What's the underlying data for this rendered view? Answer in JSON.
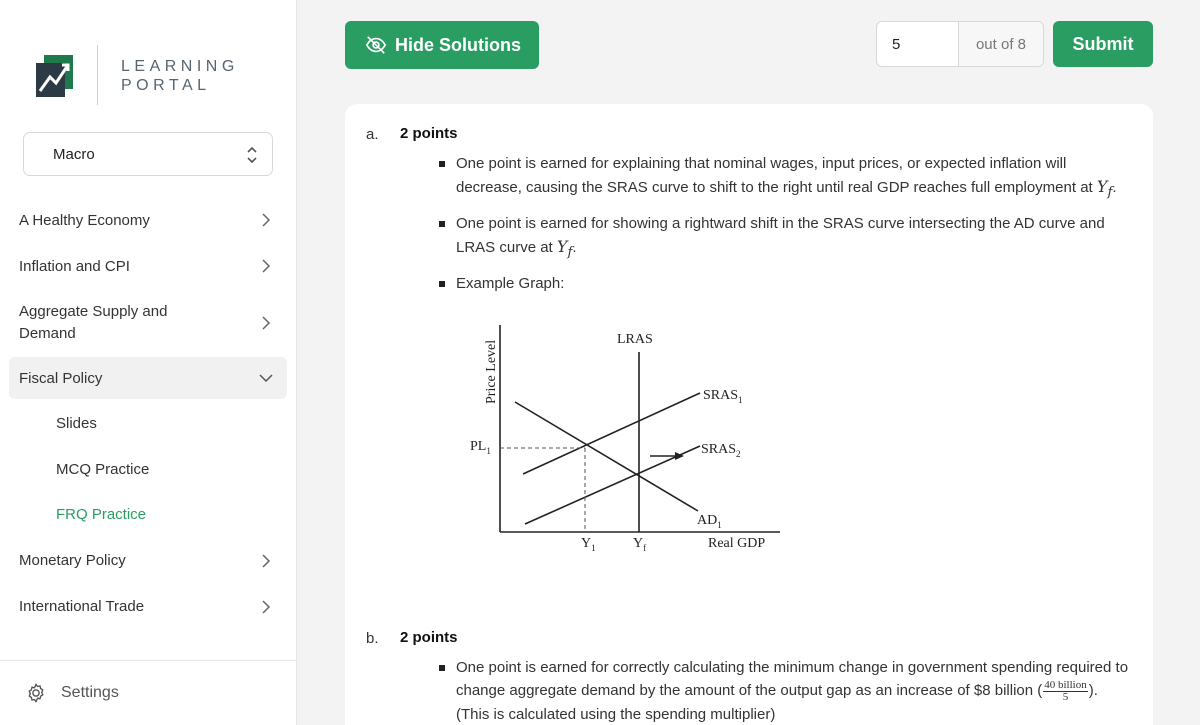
{
  "brand": {
    "line1": "LEARNING",
    "line2": "PORTAL"
  },
  "course_select": {
    "value": "Macro"
  },
  "nav": {
    "items": [
      {
        "label": "A Healthy Economy"
      },
      {
        "label": "Inflation and CPI"
      },
      {
        "label": "Aggregate Supply and Demand"
      },
      {
        "label": "Fiscal Policy"
      },
      {
        "label": "Monetary Policy"
      },
      {
        "label": "International Trade"
      }
    ],
    "fiscal_subitems": [
      {
        "label": "Slides"
      },
      {
        "label": "MCQ Practice"
      },
      {
        "label": "FRQ Practice"
      }
    ]
  },
  "settings": {
    "label": "Settings"
  },
  "toolbar": {
    "hide_solutions_label": "Hide Solutions",
    "current_question": "5",
    "out_of_label": "out of 8",
    "submit_label": "Submit"
  },
  "colors": {
    "accent": "#2a9d62",
    "background": "#f3f3f3"
  },
  "parts": {
    "a": {
      "letter": "a.",
      "points": "2 points",
      "bullet1": "One point is earned for explaining that nominal wages, input prices, or expected inflation will decrease, causing the SRAS curve to shift to the right until real GDP reaches full employment at",
      "bullet2": "One point is earned for showing a rightward shift in the SRAS curve intersecting the AD curve and LRAS curve at",
      "bullet3": "Example Graph:",
      "math_yf": "Y",
      "math_sub": "f",
      "period": "."
    },
    "b": {
      "letter": "b.",
      "points": "2 points",
      "bullet1_main": "One point is earned for correctly calculating the minimum change in government spending required to change aggregate demand by the amount of the output gap as an increase of $8 billion (",
      "frac_num": "40 billion",
      "frac_den": "5",
      "bullet1_tail": "). (This is calculated using the spending multiplier)"
    }
  },
  "graph": {
    "ylabel": "Price Level",
    "xlabel": "Real GDP",
    "lras": "LRAS",
    "sras1": "SRAS",
    "sras1_sub": "1",
    "sras2": "SRAS",
    "sras2_sub": "2",
    "ad": "AD",
    "ad_sub": "1",
    "pl": "PL",
    "pl_sub": "1",
    "y1": "Y",
    "y1_sub": "1",
    "yf": "Y",
    "yf_sub": "f"
  }
}
